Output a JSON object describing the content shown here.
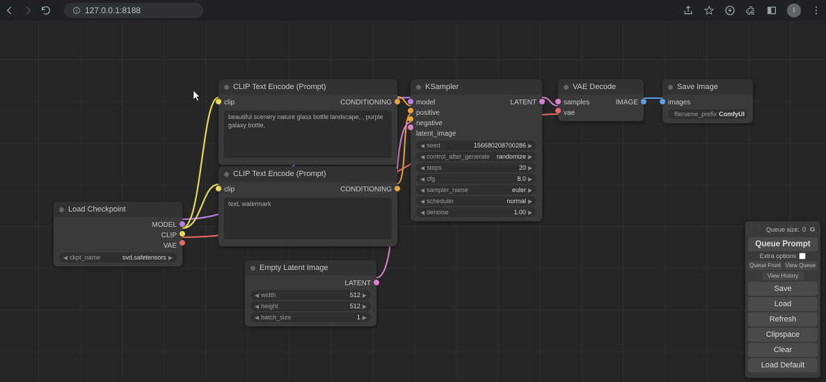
{
  "browser": {
    "url_display": "127.0.0.1:8188",
    "avatar_initial": "I"
  },
  "nodes": {
    "load_checkpoint": {
      "title": "Load Checkpoint",
      "outputs": {
        "model": "MODEL",
        "clip": "CLIP",
        "vae": "VAE"
      },
      "ckpt_name_label": "ckpt_name",
      "ckpt_name_value": "svd.safetensors"
    },
    "clip_pos": {
      "title": "CLIP Text Encode (Prompt)",
      "input": "clip",
      "output": "CONDITIONING",
      "text": "beautiful scenery nature glass bottle landscape, , purple galaxy bottle,"
    },
    "clip_neg": {
      "title": "CLIP Text Encode (Prompt)",
      "input": "clip",
      "output": "CONDITIONING",
      "text": "text, watermark"
    },
    "empty_latent": {
      "title": "Empty Latent Image",
      "output": "LATENT",
      "width_label": "width",
      "width_value": "512",
      "height_label": "height",
      "height_value": "512",
      "batch_label": "batch_size",
      "batch_value": "1"
    },
    "ksampler": {
      "title": "KSampler",
      "inputs": {
        "model": "model",
        "positive": "positive",
        "negative": "negative",
        "latent_image": "latent_image"
      },
      "output": "LATENT",
      "seed_label": "seed",
      "seed_value": "156680208700286",
      "control_label": "control_after_generate",
      "control_value": "randomize",
      "steps_label": "steps",
      "steps_value": "20",
      "cfg_label": "cfg",
      "cfg_value": "8.0",
      "sampler_label": "sampler_name",
      "sampler_value": "euler",
      "scheduler_label": "scheduler",
      "scheduler_value": "normal",
      "denoise_label": "denoise",
      "denoise_value": "1.00"
    },
    "vae_decode": {
      "title": "VAE Decode",
      "inputs": {
        "samples": "samples",
        "vae": "vae"
      },
      "output": "IMAGE"
    },
    "save_image": {
      "title": "Save Image",
      "input": "images",
      "prefix_label": "filename_prefix",
      "prefix_value": "ComfyUI"
    }
  },
  "panel": {
    "queue_size_label": "Queue size:",
    "queue_size_value": "0",
    "queue_prompt": "Queue Prompt",
    "extra_options": "Extra options",
    "queue_front": "Queue Front",
    "view_queue": "View Queue",
    "view_history": "View History",
    "save": "Save",
    "load": "Load",
    "refresh": "Refresh",
    "clipspace": "Clipspace",
    "clear": "Clear",
    "load_default": "Load Default"
  }
}
